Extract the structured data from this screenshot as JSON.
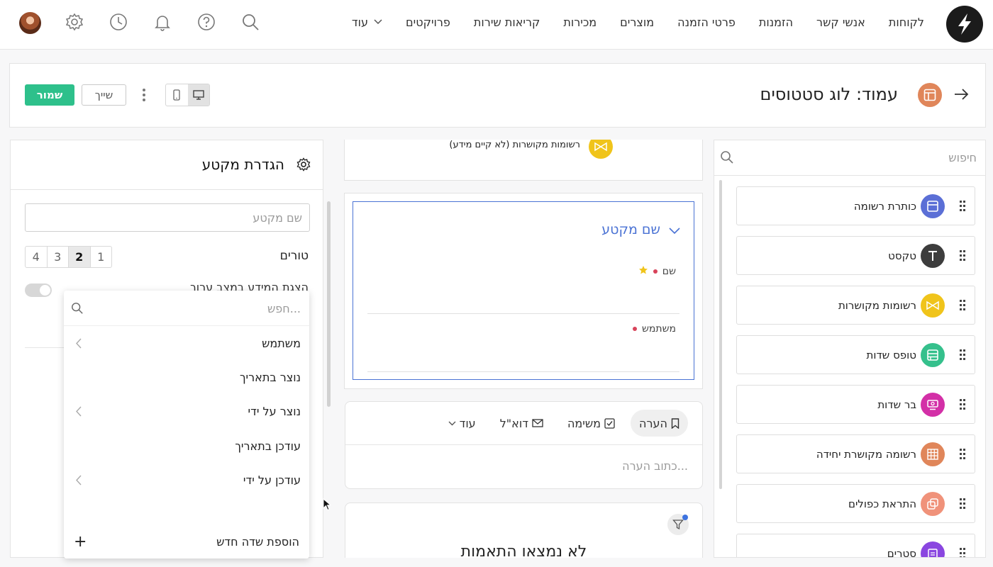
{
  "nav": {
    "items": [
      "לקוחות",
      "אנשי קשר",
      "הזמנות",
      "פרטי הזמנה",
      "מוצרים",
      "מכירות",
      "קריאות שירות",
      "פרויקטים"
    ],
    "more_label": "עוד"
  },
  "top_icons": [
    "search-icon",
    "help-icon",
    "bell-icon",
    "history-icon",
    "gear-icon",
    "avatar"
  ],
  "page": {
    "title": "עמוד: לוג סטטוסים",
    "save_label": "שמור",
    "assign_label": "שייך"
  },
  "components": {
    "search_placeholder": "חיפוש",
    "items": [
      {
        "label": "כותרת רשומה",
        "icon": "record-header-icon",
        "color": "#5b6fd6"
      },
      {
        "label": "טקסט",
        "icon": "text-icon",
        "color": "#3d3d3d"
      },
      {
        "label": "רשומות מקושרות",
        "icon": "linked-records-icon",
        "color": "#f0c41b"
      },
      {
        "label": "טופס שדות",
        "icon": "field-form-icon",
        "color": "#35c08c"
      },
      {
        "label": "בר שדות",
        "icon": "field-bar-icon",
        "color": "#d330a7"
      },
      {
        "label": "רשומה מקושרת יחידה",
        "icon": "single-linked-record-icon",
        "color": "#e0865a"
      },
      {
        "label": "התראת כפולים",
        "icon": "duplicates-alert-icon",
        "color": "#f0927a"
      },
      {
        "label": "סטרים",
        "icon": "stream-icon",
        "color": "#8a46e0"
      }
    ]
  },
  "canvas": {
    "linked_records_text": "רשומות מקושרות (לא קיים מידע)",
    "section_name": "שם מקטע",
    "fields": [
      "שם",
      "משתמש"
    ],
    "activity_tabs": [
      "הערה",
      "משימה",
      "דוא\"ל"
    ],
    "activity_more": "עוד",
    "note_placeholder": "כתוב הערה...",
    "no_match": "לא נמצאו התאמות"
  },
  "section_settings": {
    "title": "הגדרת מקטע",
    "name_placeholder": "שם מקטע",
    "columns_label": "טורים",
    "columns_options": [
      "1",
      "2",
      "3",
      "4"
    ],
    "columns_selected": "2",
    "show_hint_label": "הצגת המידע במצב ערוך"
  },
  "dropdown": {
    "search_placeholder": "חפש...",
    "items": [
      {
        "label": "משתמש",
        "has_sub": true
      },
      {
        "label": "נוצר בתאריך",
        "has_sub": false
      },
      {
        "label": "נוצר על ידי",
        "has_sub": true
      },
      {
        "label": "עודכן בתאריך",
        "has_sub": false
      },
      {
        "label": "עודכן על ידי",
        "has_sub": true
      }
    ],
    "add_label": "הוספת שדה חדש"
  }
}
